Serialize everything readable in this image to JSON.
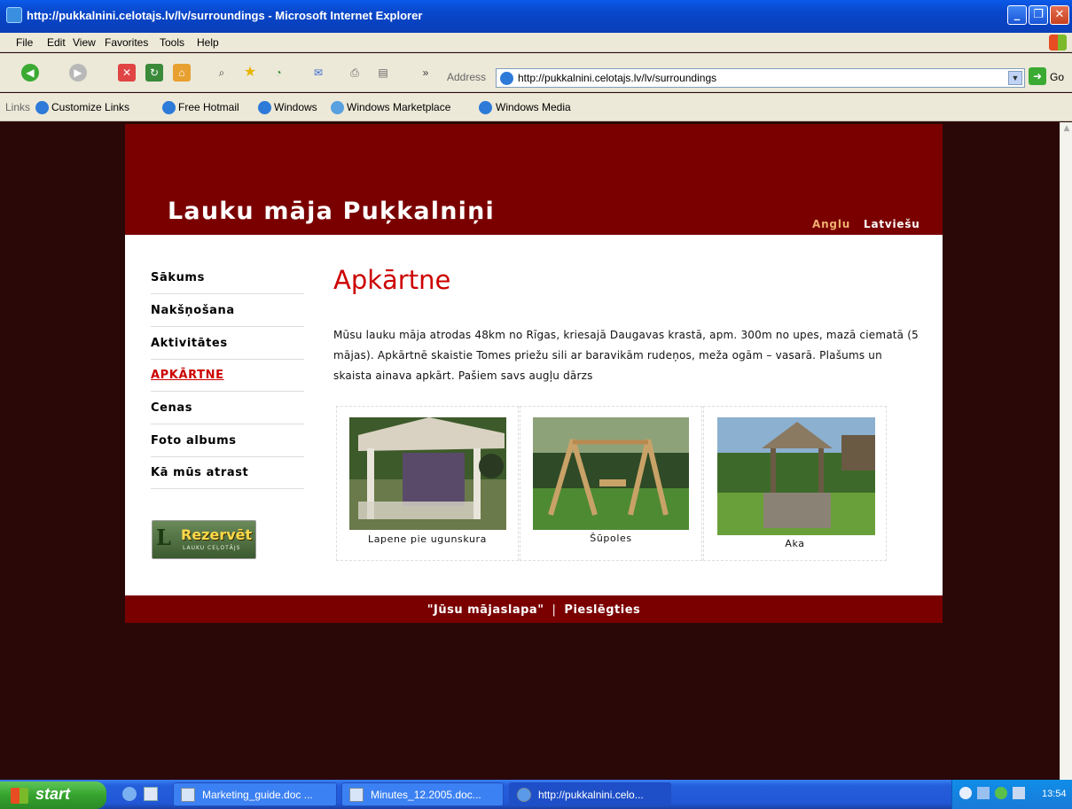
{
  "window": {
    "title": "http://pukkalnini.celotajs.lv/lv/surroundings - Microsoft Internet Explorer"
  },
  "menu": [
    "File",
    "Edit",
    "View",
    "Favorites",
    "Tools",
    "Help"
  ],
  "address": {
    "label": "Address",
    "url": "http://pukkalnini.celotajs.lv/lv/surroundings",
    "go": "Go"
  },
  "links_bar": {
    "label": "Links",
    "items": [
      "Customize Links",
      "Free Hotmail",
      "Windows",
      "Windows Marketplace",
      "Windows Media"
    ]
  },
  "site": {
    "title": "Lauku māja Puķkalniņi",
    "lang": [
      "Anglu",
      "Latviešu"
    ],
    "nav": [
      "Sākums",
      "Nakšņošana",
      "Aktivitātes",
      "APKĀRTNE",
      "Cenas",
      "Foto albums",
      "Kā mūs atrast"
    ],
    "reserve": {
      "text": "Rezervēt",
      "sub": "LAUKU CEĻOTĀJS"
    },
    "heading": "Apkārtne",
    "intro": "Mūsu lauku māja atrodas 48km no Rīgas, kriesajā Daugavas krastā, apm. 300m no upes, mazā ciematā (5 mājas). Apkārtnē skaistie Tomes priežu sili ar baravikām rudeņos, meža ogām – vasarā. Plašums un skaista ainava apkārt. Pašiem savs augļu dārzs",
    "photos": [
      {
        "caption": "Lapene pie ugunskura"
      },
      {
        "caption": "Šūpoles"
      },
      {
        "caption": "Aka"
      }
    ],
    "footer": {
      "link1": "\"Jūsu mājaslapa\"",
      "sep": "|",
      "link2": "Pieslēgties"
    }
  },
  "taskbar": {
    "start": "start",
    "tasks": [
      "Marketing_guide.doc ...",
      "Minutes_12.2005.doc...",
      "http://pukkalnini.celo..."
    ],
    "clock": "13:54"
  }
}
